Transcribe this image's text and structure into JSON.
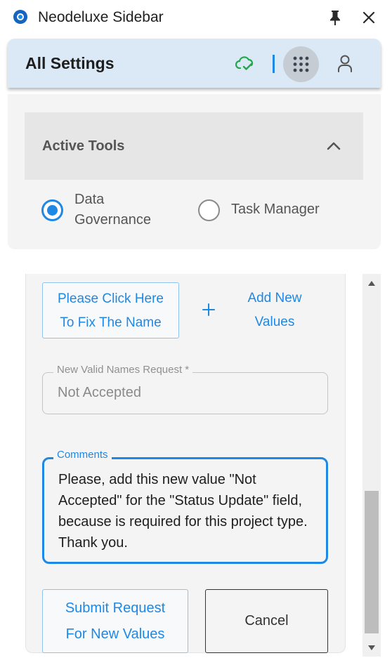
{
  "window": {
    "title": "Neodeluxe Sidebar",
    "logo_color": "#1565c0"
  },
  "header": {
    "title": "All Settings",
    "accent": "#1e88e5",
    "cloud_status_color": "#20a84a"
  },
  "active_tools": {
    "title": "Active Tools",
    "options": [
      {
        "label_line1": "Data",
        "label_line2": "Governance",
        "selected": true
      },
      {
        "label": "Task Manager",
        "selected": false
      }
    ]
  },
  "form": {
    "fix_name_line1": "Please Click Here",
    "fix_name_line2": "To Fix The Name",
    "add_values_line1": "Add New",
    "add_values_line2": "Values",
    "valid_names_label": "New Valid Names Request *",
    "valid_names_value": "Not Accepted",
    "comments_label": "Comments",
    "comments_value": "Please, add this new value \"Not Accepted\" for the \"Status Update\" field, because is required for this project type. Thank you.",
    "submit_line1": "Submit Request",
    "submit_line2": "For New Values",
    "cancel_label": "Cancel"
  }
}
